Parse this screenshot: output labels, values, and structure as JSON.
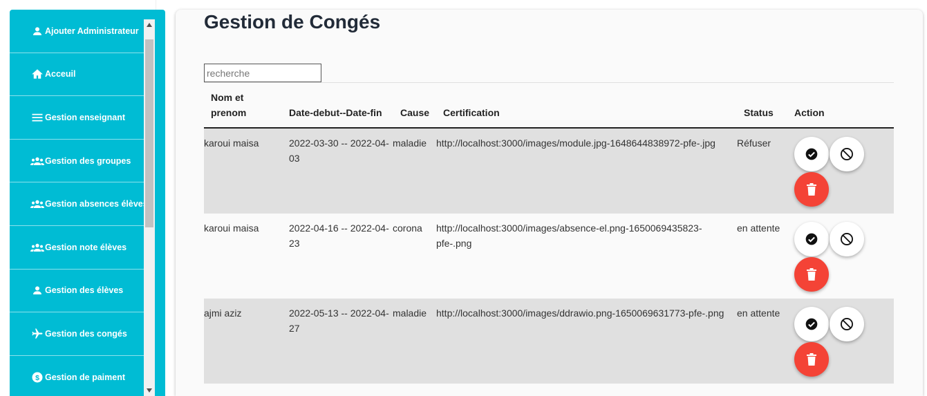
{
  "sidebar": {
    "items": [
      {
        "label": "Ajouter Administrateur",
        "icon": "person-icon"
      },
      {
        "label": "Acceuil",
        "icon": "home-icon"
      },
      {
        "label": "Gestion enseignant",
        "icon": "menu-icon"
      },
      {
        "label": "Gestion des groupes",
        "icon": "group-icon"
      },
      {
        "label": "Gestion absences élèves",
        "icon": "group-icon"
      },
      {
        "label": "Gestion note élèves",
        "icon": "group-icon"
      },
      {
        "label": "Gestion des élèves",
        "icon": "person-icon"
      },
      {
        "label": "Gestion des congés",
        "icon": "airplane-icon"
      },
      {
        "label": "Gestion de paiment",
        "icon": "dollar-icon"
      }
    ],
    "color": "#00bcd4"
  },
  "main": {
    "title": "Gestion de Congés",
    "search": {
      "placeholder": "recherche",
      "value": ""
    },
    "table": {
      "headers": {
        "nom": "Nom et prenom",
        "dates": "Date-debut--Date-fin",
        "cause": "Cause",
        "certification": "Certification",
        "status": "Status",
        "action": "Action"
      },
      "rows": [
        {
          "nom": "karoui maisa",
          "dates": "2022-03-30 -- 2022-04-03",
          "cause": "maladie",
          "certification": "http://localhost:3000/images/module.jpg-1648644838972-pfe-.jpg",
          "status": "Réfuser"
        },
        {
          "nom": "karoui maisa",
          "dates": "2022-04-16 -- 2022-04-23",
          "cause": "corona",
          "certification": "http://localhost:3000/images/absence-el.png-1650069435823-pfe-.png",
          "status": "en attente"
        },
        {
          "nom": "ajmi aziz",
          "dates": "2022-05-13 -- 2022-04-27",
          "cause": "maladie",
          "certification": "http://localhost:3000/images/ddrawio.png-1650069631773-pfe-.png",
          "status": "en attente"
        }
      ]
    },
    "actions": {
      "accept_icon": "check-circle-icon",
      "refuse_icon": "block-icon",
      "delete_icon": "trash-icon",
      "delete_color": "#f44336"
    }
  }
}
